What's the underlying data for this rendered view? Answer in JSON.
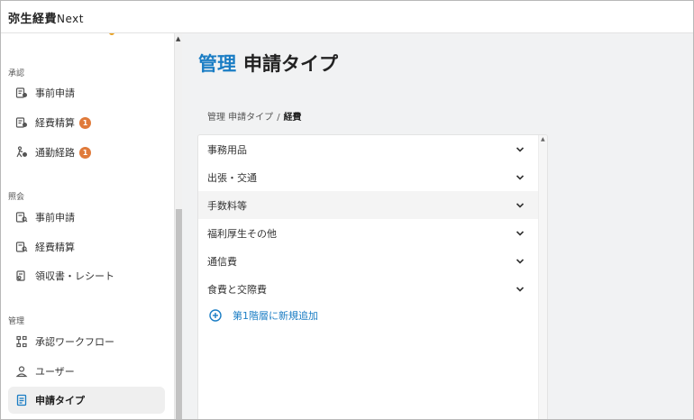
{
  "app": {
    "name": "弥生経費",
    "suffix": "Next"
  },
  "sidebar": {
    "sections": [
      {
        "label": "承認",
        "items": [
          {
            "label": "事前申請",
            "icon": "approval-request-icon",
            "badge": ""
          },
          {
            "label": "経費精算",
            "icon": "approval-expense-icon",
            "badge": "1"
          },
          {
            "label": "通勤経路",
            "icon": "commute-icon",
            "badge": "1"
          }
        ]
      },
      {
        "label": "照会",
        "items": [
          {
            "label": "事前申請",
            "icon": "document-search-icon",
            "badge": ""
          },
          {
            "label": "経費精算",
            "icon": "document-check-icon",
            "badge": ""
          },
          {
            "label": "領収書・レシート",
            "icon": "receipt-user-icon",
            "badge": ""
          }
        ]
      },
      {
        "label": "管理",
        "items": [
          {
            "label": "承認ワークフロー",
            "icon": "workflow-icon",
            "badge": ""
          },
          {
            "label": "ユーザー",
            "icon": "user-icon",
            "badge": ""
          },
          {
            "label": "申請タイプ",
            "icon": "application-type-icon",
            "badge": "",
            "active": true
          }
        ]
      }
    ]
  },
  "main": {
    "title_accent": "管理",
    "title_rest": "申請タイプ",
    "breadcrumb": {
      "parent": "管理 申請タイプ",
      "separator": "/",
      "current": "経費"
    },
    "categories": [
      {
        "label": "事務用品"
      },
      {
        "label": "出張・交通"
      },
      {
        "label": "手数料等",
        "highlighted": true
      },
      {
        "label": "福利厚生その他"
      },
      {
        "label": "通信費"
      },
      {
        "label": "食費と交際費"
      }
    ],
    "add_label": "第1階層に新規追加"
  },
  "colors": {
    "accent": "#1a7dc4",
    "badge": "#e07a3a",
    "background": "#f1f2f3"
  }
}
